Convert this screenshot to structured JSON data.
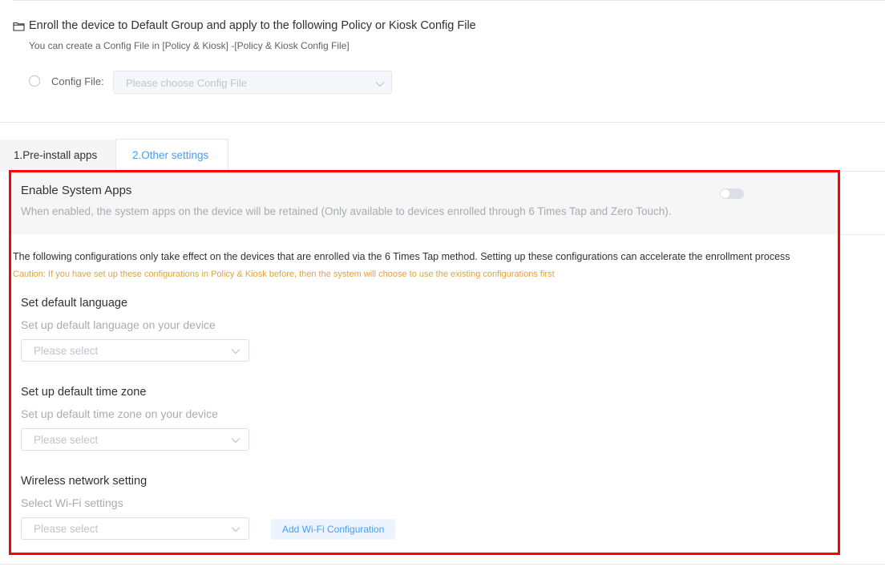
{
  "enroll": {
    "title": "Enroll the device to Default Group and apply to the following Policy or Kiosk Config File",
    "subtitle": "You can create a Config File in [Policy & Kiosk] -[Policy & Kiosk Config File]",
    "config_label": "Config File:",
    "config_placeholder": "Please choose Config File"
  },
  "tabs": [
    {
      "label": "1.Pre-install apps",
      "active": true
    },
    {
      "label": "2.Other settings",
      "active": false
    }
  ],
  "system_apps": {
    "title": "Enable System Apps",
    "description": "When enabled, the system apps on the device will be retained (Only available to devices enrolled through 6 Times Tap and Zero Touch).",
    "enabled": false
  },
  "info": "The following configurations only take effect on the devices that are enrolled via the 6 Times Tap method. Setting up these configurations can accelerate the enrollment process",
  "caution": "Caution: If you have set up these configurations in Policy & Kiosk before, then the system will choose to use the existing configurations first",
  "language": {
    "title": "Set default language",
    "subtitle": "Set up default language on your device",
    "placeholder": "Please select"
  },
  "timezone": {
    "title": "Set up default time zone",
    "subtitle": "Set up default time zone on your device",
    "placeholder": "Please select"
  },
  "wifi": {
    "title": "Wireless network setting",
    "subtitle": "Select Wi-Fi settings",
    "placeholder": "Please select",
    "add_button": "Add Wi-Fi Configuration"
  },
  "colors": {
    "accent": "#409eff",
    "caution": "#e6a23c",
    "highlight_frame": "#ff0000"
  }
}
